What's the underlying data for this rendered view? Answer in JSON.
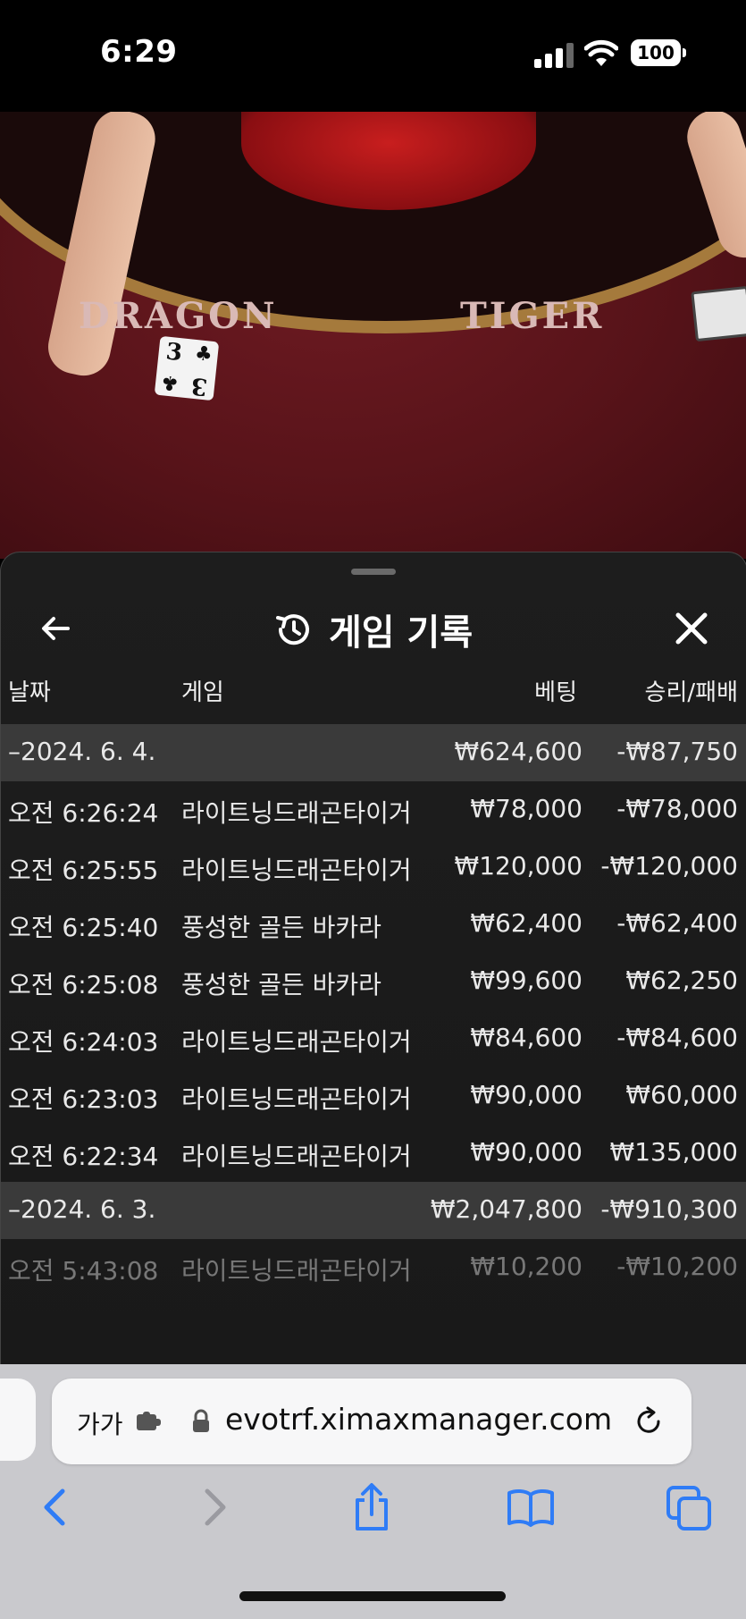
{
  "status_bar": {
    "time": "6:29",
    "battery": "100"
  },
  "video": {
    "dragon_label": "DRAGON",
    "tiger_label": "TIGER",
    "card_rank": "3",
    "card_suit": "♣"
  },
  "panel": {
    "title": "게임 기록",
    "columns": {
      "date": "날짜",
      "game": "게임",
      "bet": "베팅",
      "result": "승리/패배"
    },
    "rows": [
      {
        "type": "date",
        "c1": "–2024. 6. 4.",
        "c2": "",
        "c3": "₩624,600",
        "c4": "-₩87,750"
      },
      {
        "type": "item",
        "c1": "오전 6:26:24",
        "c2": "라이트닝드래곤타이거",
        "c3": "₩78,000",
        "c4": "-₩78,000"
      },
      {
        "type": "item",
        "c1": "오전 6:25:55",
        "c2": "라이트닝드래곤타이거",
        "c3": "₩120,000",
        "c4": "-₩120,000"
      },
      {
        "type": "item",
        "c1": "오전 6:25:40",
        "c2": "풍성한 골든 바카라",
        "c3": "₩62,400",
        "c4": "-₩62,400"
      },
      {
        "type": "item",
        "c1": "오전 6:25:08",
        "c2": "풍성한 골든 바카라",
        "c3": "₩99,600",
        "c4": "₩62,250"
      },
      {
        "type": "item",
        "c1": "오전 6:24:03",
        "c2": "라이트닝드래곤타이거",
        "c3": "₩84,600",
        "c4": "-₩84,600"
      },
      {
        "type": "item",
        "c1": "오전 6:23:03",
        "c2": "라이트닝드래곤타이거",
        "c3": "₩90,000",
        "c4": "₩60,000"
      },
      {
        "type": "item",
        "c1": "오전 6:22:34",
        "c2": "라이트닝드래곤타이거",
        "c3": "₩90,000",
        "c4": "₩135,000"
      },
      {
        "type": "date",
        "c1": "–2024. 6. 3.",
        "c2": "",
        "c3": "₩2,047,800",
        "c4": "-₩910,300"
      },
      {
        "type": "faded",
        "c1": "오전 5:43:08",
        "c2": "라이트닝드래곤타이거",
        "c3": "₩10,200",
        "c4": "-₩10,200"
      }
    ]
  },
  "browser": {
    "text_size": "가가",
    "url": "evotrf.ximaxmanager.com"
  },
  "colors": {
    "accent": "#2f7cf6",
    "panel_bg": "#1b1b1b",
    "date_row_bg": "#3a3a3a",
    "felt": "#571319"
  },
  "icons": [
    "back-arrow-icon",
    "history-icon",
    "close-icon",
    "extension-icon",
    "lock-icon",
    "reload-icon",
    "chevron-left-icon",
    "chevron-right-icon",
    "share-icon",
    "bookmarks-icon",
    "tabs-icon"
  ]
}
